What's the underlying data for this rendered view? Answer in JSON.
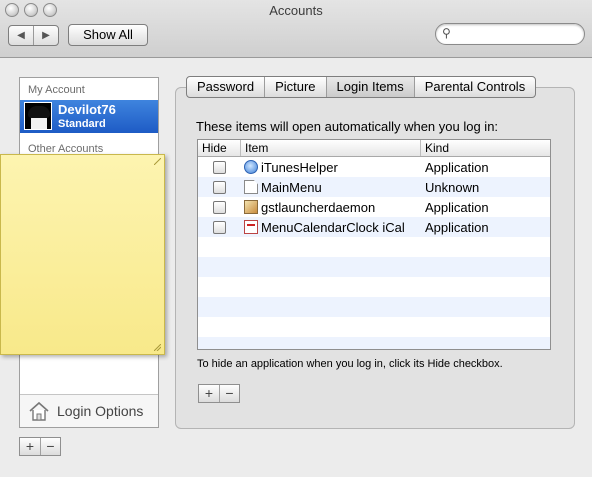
{
  "window": {
    "title": "Accounts"
  },
  "toolbar": {
    "back_label": "◀",
    "forward_label": "▶",
    "show_all_label": "Show All",
    "search_placeholder": "",
    "search_icon": "magnifier-icon"
  },
  "sidebar": {
    "my_account_header": "My Account",
    "current_user": {
      "name": "Devilot76",
      "type": "Standard"
    },
    "other_accounts_header": "Other Accounts",
    "login_options_label": "Login Options",
    "add_label": "+",
    "remove_label": "−"
  },
  "tabs": [
    {
      "label": "Password"
    },
    {
      "label": "Picture"
    },
    {
      "label": "Login Items",
      "active": true
    },
    {
      "label": "Parental Controls"
    }
  ],
  "login_items": {
    "description": "These items will open automatically when you log in:",
    "columns": {
      "hide": "Hide",
      "item": "Item",
      "kind": "Kind"
    },
    "rows": [
      {
        "hide": false,
        "icon": "itunes-icon",
        "item": "iTunesHelper",
        "kind": "Application"
      },
      {
        "hide": false,
        "icon": "document-icon",
        "item": "MainMenu",
        "kind": "Unknown"
      },
      {
        "hide": false,
        "icon": "gstlauncher-icon",
        "item": "gstlauncherdaemon",
        "kind": "Application"
      },
      {
        "hide": false,
        "icon": "ical-icon",
        "item": "MenuCalendarClock iCal",
        "kind": "Application"
      }
    ],
    "hint": "To hide an application when you log in, click its Hide checkbox.",
    "add_label": "+",
    "remove_label": "−"
  },
  "colors": {
    "selection": "#2a6ad3",
    "sticky_note": "#fbf0a0",
    "row_stripe": "#edf3fe"
  }
}
